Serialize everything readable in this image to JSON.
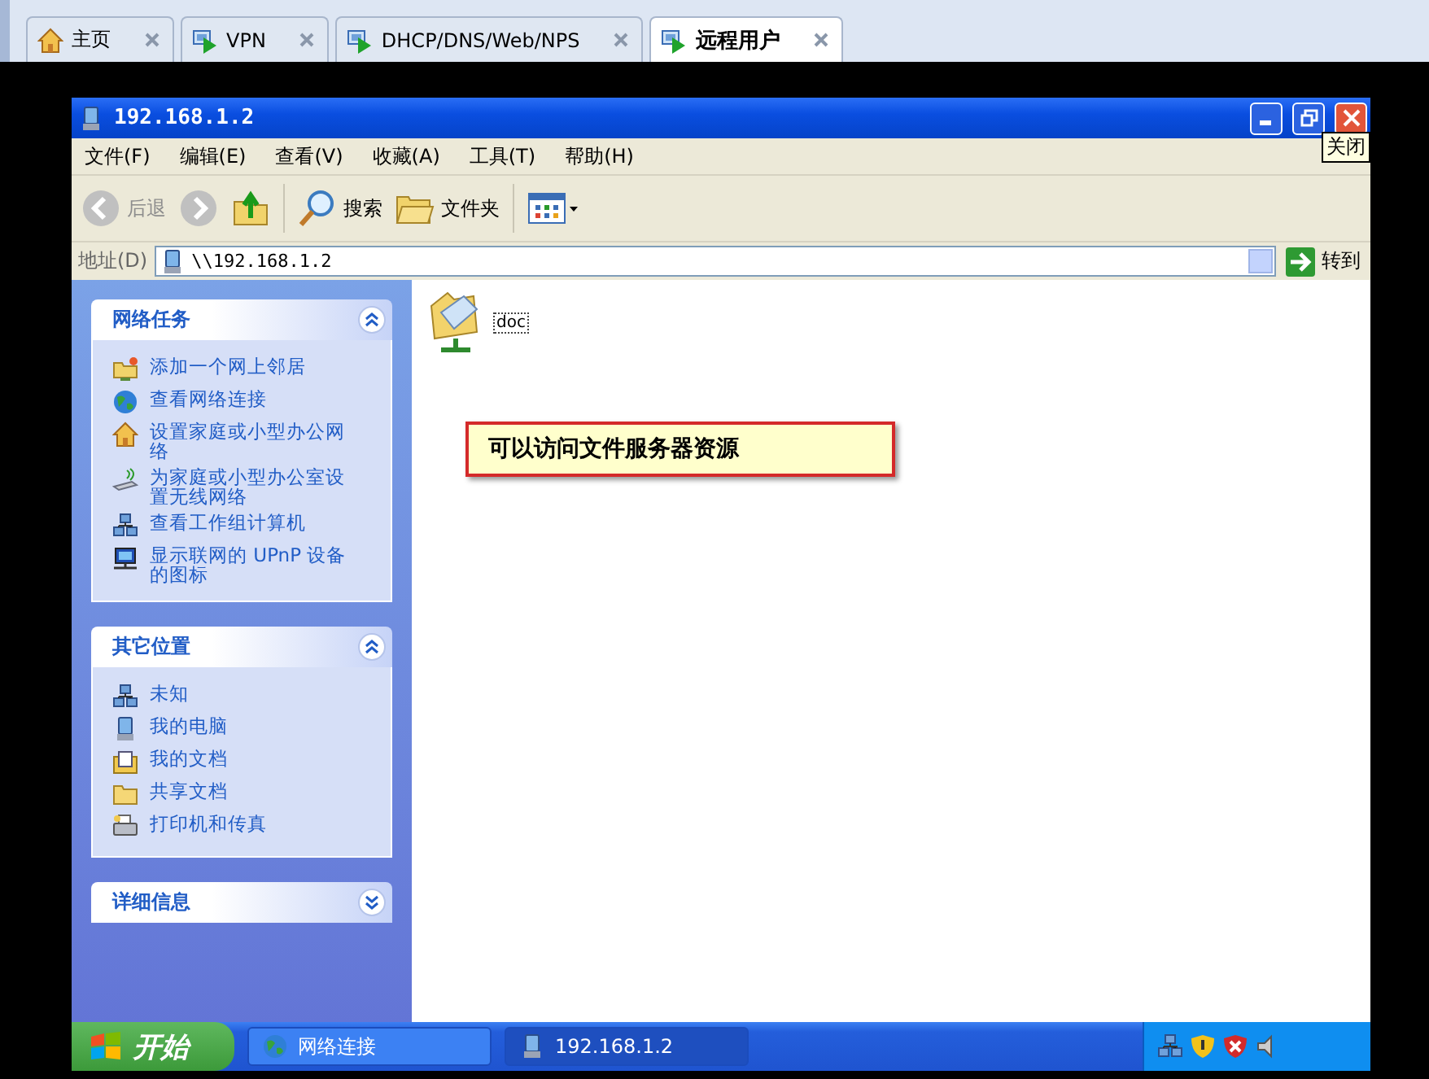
{
  "tabs": [
    {
      "label": "主页",
      "kind": "home",
      "selected": false
    },
    {
      "label": "VPN",
      "kind": "remote",
      "selected": false
    },
    {
      "label": "DHCP/DNS/Web/NPS",
      "kind": "remote",
      "selected": false
    },
    {
      "label": "远程用户",
      "kind": "remote",
      "selected": true
    }
  ],
  "window": {
    "title": "192.168.1.2",
    "tooltip": "关闭",
    "menu": [
      "文件(F)",
      "编辑(E)",
      "查看(V)",
      "收藏(A)",
      "工具(T)",
      "帮助(H)"
    ],
    "toolbar": {
      "back": "后退",
      "search": "搜索",
      "folders": "文件夹"
    },
    "address": {
      "label": "地址(D)",
      "value": "\\\\192.168.1.2",
      "go": "转到"
    },
    "panels": [
      {
        "title": "网络任务",
        "expanded": true,
        "items": [
          {
            "kind": "neighbor",
            "label": "添加一个网上邻居"
          },
          {
            "kind": "globe",
            "label": "查看网络连接"
          },
          {
            "kind": "home",
            "label": "设置家庭或小型办公网络"
          },
          {
            "kind": "wireless",
            "label": "为家庭或小型办公室设置无线网络"
          },
          {
            "kind": "workgroup",
            "label": "查看工作组计算机"
          },
          {
            "kind": "upnp",
            "label": "显示联网的 UPnP 设备的图标"
          }
        ]
      },
      {
        "title": "其它位置",
        "expanded": true,
        "items": [
          {
            "kind": "workgroup",
            "label": "未知"
          },
          {
            "kind": "computer",
            "label": "我的电脑"
          },
          {
            "kind": "documents",
            "label": "我的文档"
          },
          {
            "kind": "folder",
            "label": "共享文档"
          },
          {
            "kind": "printer",
            "label": "打印机和传真"
          }
        ]
      },
      {
        "title": "详细信息",
        "expanded": false
      }
    ],
    "files": [
      {
        "name": "doc"
      }
    ],
    "callout": "可以访问文件服务器资源"
  },
  "taskbar": {
    "start": "开始",
    "tasks": [
      {
        "label": "网络连接",
        "kind": "globe",
        "selected": false
      },
      {
        "label": "192.168.1.2",
        "kind": "computer",
        "selected": true
      }
    ]
  }
}
